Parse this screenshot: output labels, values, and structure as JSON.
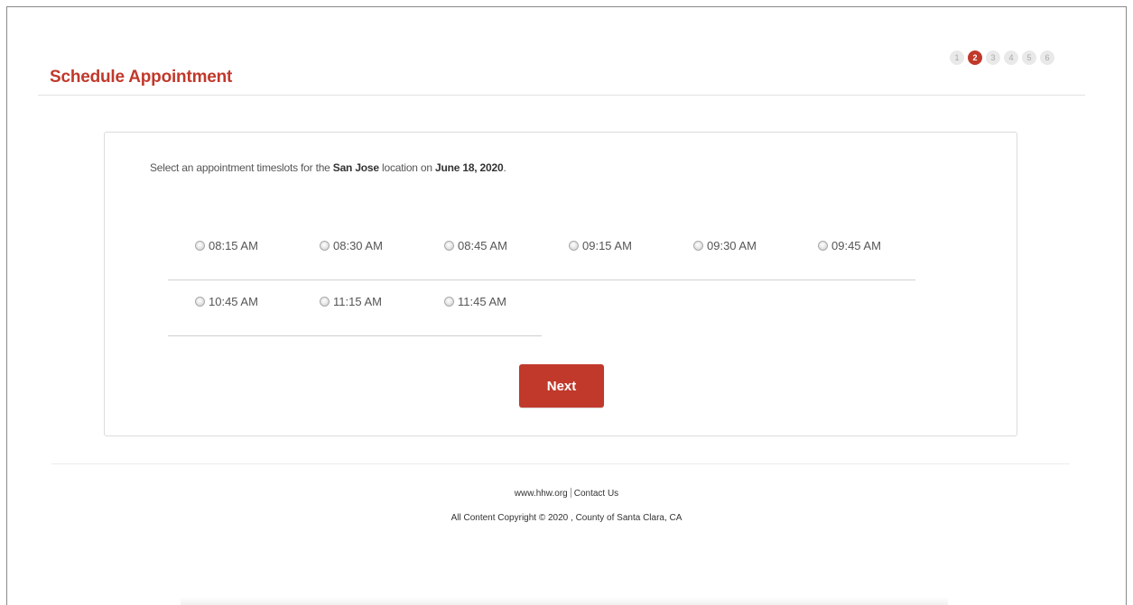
{
  "header": {
    "title": "Schedule Appointment"
  },
  "steps": [
    {
      "label": "1",
      "active": false
    },
    {
      "label": "2",
      "active": true
    },
    {
      "label": "3",
      "active": false
    },
    {
      "label": "4",
      "active": false
    },
    {
      "label": "5",
      "active": false
    },
    {
      "label": "6",
      "active": false
    }
  ],
  "instructions": {
    "prefix": "Select an appointment timeslots for the ",
    "location": "San Jose",
    "middle": " location on ",
    "date": "June 18, 2020",
    "suffix": "."
  },
  "timeslots": {
    "row1": [
      "08:15 AM",
      "08:30 AM",
      "08:45 AM",
      "09:15 AM",
      "09:30 AM",
      "09:45 AM"
    ],
    "row2": [
      "10:45 AM",
      "11:15 AM",
      "11:45 AM"
    ]
  },
  "actions": {
    "next_label": "Next"
  },
  "footer": {
    "site_link": "www.hhw.org",
    "contact_link": "Contact Us",
    "copyright": "All Content Copyright © 2020 , County of Santa Clara, CA"
  },
  "colors": {
    "accent": "#c0392b",
    "text": "#555555",
    "step_inactive": "#e9e9e9"
  }
}
